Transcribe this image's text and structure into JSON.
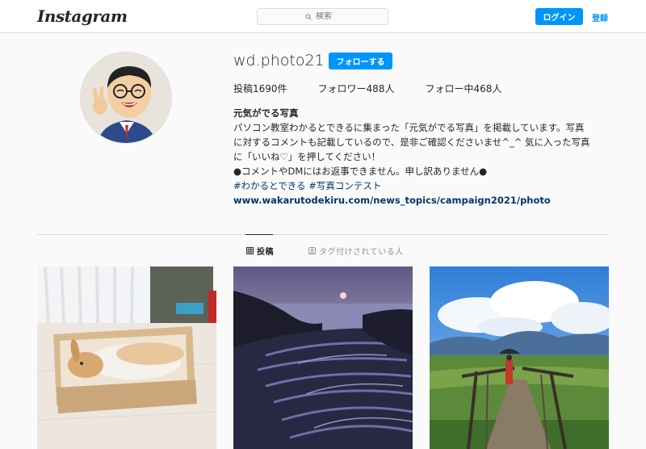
{
  "header": {
    "logo": "Instagram",
    "search_placeholder": "検索",
    "login_label": "ログイン",
    "signup_label": "登録"
  },
  "profile": {
    "username": "wd.photo21",
    "follow_label": "フォローする",
    "stats": {
      "posts": "投稿1690件",
      "followers": "フォロワー488人",
      "following": "フォロー中468人"
    },
    "bio": {
      "name": "元気がでる写真",
      "line1": "パソコン教室わかるとできるに集まった「元気がでる写真」を掲載しています。写真",
      "line2": "に対するコメントも記載しているので、是非ご確認くださいませ^_^ 気に入った写真",
      "line3": "に「いいね♡」を押してください！",
      "line4": "●コメントやDMにはお返事できません。申し訳ありません●",
      "tags": "#わかるとできる #写真コンテスト",
      "url": "www.wakarutodekiru.com/news_topics/campaign2021/photo"
    }
  },
  "tabs": {
    "posts": "投稿",
    "tagged": "タグ付けされている人"
  },
  "posts": [
    {
      "icon": "rabbit-in-box-photo"
    },
    {
      "icon": "rice-terraces-sunset-photo"
    },
    {
      "icon": "boardwalk-umbrella-photo"
    }
  ],
  "colors": {
    "accent": "#0095f6",
    "link": "#00376b",
    "border": "#dbdbdb",
    "background": "#fafafa"
  }
}
